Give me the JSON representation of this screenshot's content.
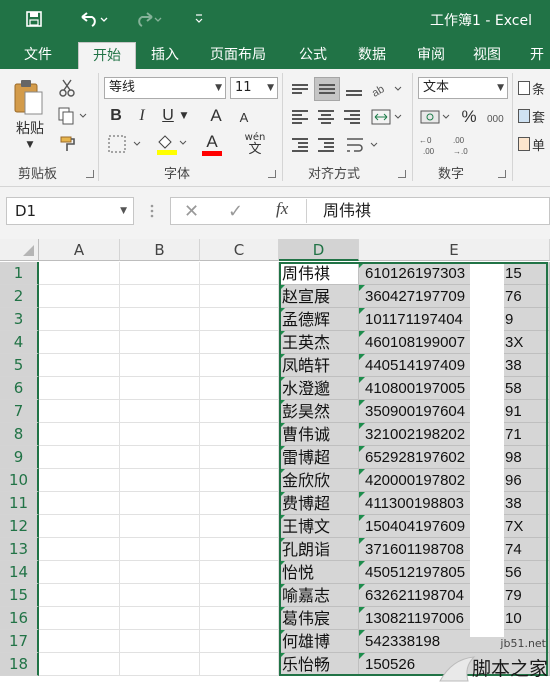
{
  "window": {
    "title": "工作簿1 - Excel"
  },
  "quick_access": {
    "save_icon": "save-icon",
    "undo_icon": "undo-icon",
    "redo_icon": "redo-icon",
    "customize_icon": "customize-icon"
  },
  "tabs": [
    "文件",
    "开始",
    "插入",
    "页面布局",
    "公式",
    "数据",
    "审阅",
    "视图",
    "开"
  ],
  "active_tab": "开始",
  "ribbon": {
    "clipboard": {
      "paste_label": "粘贴",
      "group_label": "剪贴板"
    },
    "font": {
      "font_name": "等线",
      "font_size": "11",
      "bold": "B",
      "italic": "I",
      "underline": "U",
      "grow": "A",
      "shrink": "A",
      "font_color_letter": "A",
      "phonetic": "wén",
      "phonetic_char": "文",
      "group_label": "字体",
      "fill_color": "#ffff00",
      "text_color": "#ff0000"
    },
    "alignment": {
      "group_label": "对齐方式"
    },
    "number": {
      "format": "文本",
      "percent": "%",
      "group_label": "数字"
    },
    "cut_off": [
      "条",
      "套",
      "单"
    ]
  },
  "formula_bar": {
    "name_box": "D1",
    "cancel": "✕",
    "enter": "✓",
    "fx": "fx",
    "value": "周伟祺"
  },
  "sheet": {
    "columns": [
      "A",
      "B",
      "C",
      "D",
      "E"
    ],
    "selected_column": "D",
    "rows": [
      {
        "n": "1",
        "name": "周伟祺",
        "id_left": "610126197303",
        "id_right": "15"
      },
      {
        "n": "2",
        "name": "赵宣展",
        "id_left": "360427197709",
        "id_right": "76"
      },
      {
        "n": "3",
        "name": "孟德辉",
        "id_left": "101171197404",
        "id_right": "9"
      },
      {
        "n": "4",
        "name": "王英杰",
        "id_left": "460108199007",
        "id_right": "3X"
      },
      {
        "n": "5",
        "name": "凤皓轩",
        "id_left": "440514197409",
        "id_right": "38"
      },
      {
        "n": "6",
        "name": "水澄邈",
        "id_left": "410800197005",
        "id_right": "58"
      },
      {
        "n": "7",
        "name": "彭昊然",
        "id_left": "350900197604",
        "id_right": "91"
      },
      {
        "n": "8",
        "name": "曹伟诚",
        "id_left": "321002198202",
        "id_right": "71"
      },
      {
        "n": "9",
        "name": "雷博超",
        "id_left": "652928197602",
        "id_right": "98"
      },
      {
        "n": "10",
        "name": "金欣欣",
        "id_left": "420000197802",
        "id_right": "96"
      },
      {
        "n": "11",
        "name": "费博超",
        "id_left": "411300198803",
        "id_right": "38"
      },
      {
        "n": "12",
        "name": "王博文",
        "id_left": "150404197609",
        "id_right": "7X"
      },
      {
        "n": "13",
        "name": "孔朗诣",
        "id_left": "371601198708",
        "id_right": "74"
      },
      {
        "n": "14",
        "name": "怡悦",
        "id_left": "450512197805",
        "id_right": "56"
      },
      {
        "n": "15",
        "name": "喻嘉志",
        "id_left": "632621198704",
        "id_right": "79"
      },
      {
        "n": "16",
        "name": "葛伟宸",
        "id_left": "130821197006",
        "id_right": "10"
      },
      {
        "n": "17",
        "name": "何雄博",
        "id_left": "542338198",
        "id_right": ""
      },
      {
        "n": "18",
        "name": "乐怡畅",
        "id_left": "150526",
        "id_right": ""
      }
    ]
  },
  "watermark": {
    "url": "jb51.net",
    "brand": "脚本之家"
  }
}
